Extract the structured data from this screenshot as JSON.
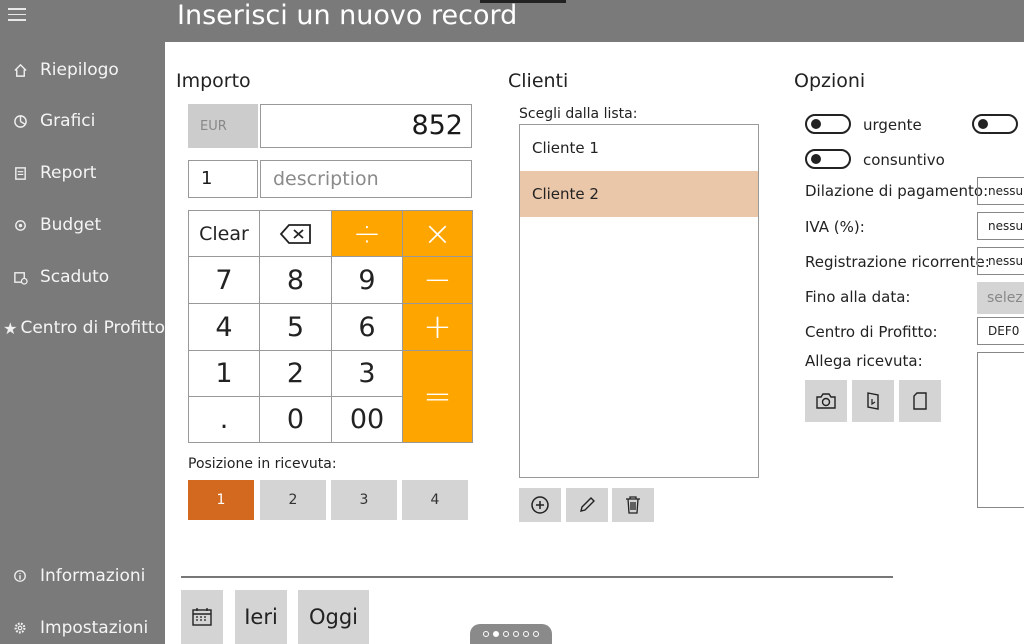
{
  "window": {
    "title": "Inserisci un nuovo record"
  },
  "sidebar": {
    "items": [
      {
        "label": "Riepilogo",
        "icon": "home-icon"
      },
      {
        "label": "Grafici",
        "icon": "pie-chart-icon"
      },
      {
        "label": "Report",
        "icon": "report-icon"
      },
      {
        "label": "Budget",
        "icon": "budget-icon"
      },
      {
        "label": "Scaduto",
        "icon": "calendar-overdue-icon"
      },
      {
        "label": "Centro di Profitto",
        "icon": "star-icon"
      }
    ],
    "footer": [
      {
        "label": "Informazioni",
        "icon": "info-icon"
      },
      {
        "label": "Impostazioni",
        "icon": "gear-icon"
      }
    ]
  },
  "importo": {
    "title": "Importo",
    "currency": "EUR",
    "amount": "852",
    "quantity": "1",
    "description_placeholder": "description",
    "keypad": {
      "clear": "Clear",
      "digits": [
        "7",
        "8",
        "9",
        "4",
        "5",
        "6",
        "1",
        "2",
        "3",
        ".",
        "0",
        "00"
      ],
      "divide": "÷",
      "multiply": "×",
      "minus": "−",
      "plus": "+",
      "equals": "="
    },
    "position_label": "Posizione in ricevuta:",
    "positions": [
      "1",
      "2",
      "3",
      "4"
    ],
    "position_selected": "1"
  },
  "clienti": {
    "title": "Clienti",
    "list_label": "Scegli dalla lista:",
    "items": [
      "Cliente 1",
      "Cliente 2"
    ],
    "selected": "Cliente 2"
  },
  "opzioni": {
    "title": "Opzioni",
    "toggles": {
      "urgente": "urgente",
      "consuntivo": "consuntivo"
    },
    "fields": {
      "dilazione_label": "Dilazione di pagamento:",
      "dilazione_value": "nessuna",
      "iva_label": "IVA (%):",
      "iva_value": "nessuna",
      "ricorrente_label": "Registrazione ricorrente:",
      "ricorrente_value": "nessuna",
      "fino_label": "Fino alla data:",
      "fino_value": "seleziona",
      "centro_label": "Centro di Profitto:",
      "centro_value": "DEF0"
    },
    "allega_label": "Allega ricevuta:"
  },
  "bottom": {
    "ieri": "Ieri",
    "oggi": "Oggi"
  },
  "colors": {
    "accent": "#ffa500",
    "selected_position": "#d2691e",
    "selected_client": "#ebc7aa",
    "chrome": "#7a7a7a"
  }
}
